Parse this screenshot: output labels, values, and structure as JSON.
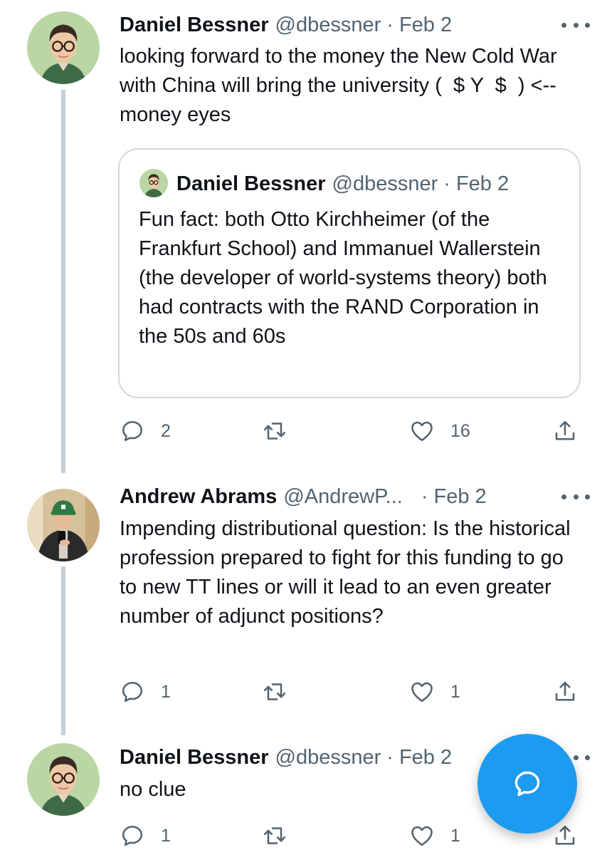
{
  "tweets": [
    {
      "name": "Daniel Bessner",
      "handle": "@dbessner",
      "separator": "·",
      "date": "Feb 2",
      "text": "looking forward to the money the New Cold War with China will bring the university (  $ Y  $  ) <--money eyes",
      "quote": {
        "name": "Daniel Bessner",
        "handle": "@dbessner",
        "separator": "·",
        "date": "Feb 2",
        "text": "Fun fact: both Otto Kirchheimer (of the Frankfurt School) and Immanuel Wallerstein (the developer of world-systems theory) both had contracts with the RAND Corporation in the 50s and 60s"
      },
      "reply_count": "2",
      "retweet_count": "",
      "like_count": "16"
    },
    {
      "name": "Andrew Abrams",
      "handle": "@AndrewP...",
      "separator": "·",
      "date": "Feb 2",
      "text": "Impending distributional question: Is the historical profession prepared to fight for this funding to go to new TT lines or will it lead to an even greater number of adjunct positions?",
      "reply_count": "1",
      "retweet_count": "",
      "like_count": "1"
    },
    {
      "name": "Daniel Bessner",
      "handle": "@dbessner",
      "separator": "·",
      "date": "Feb 2",
      "text": "no clue",
      "reply_count": "1",
      "retweet_count": "",
      "like_count": "1"
    }
  ],
  "icons": {
    "reply": "reply-icon",
    "retweet": "retweet-icon",
    "like": "heart-icon",
    "share": "share-icon",
    "more": "more-dots-icon",
    "compose": "compose-reply-icon"
  },
  "colors": {
    "accent": "#1d9bf0",
    "secondary_text": "#536471",
    "thread_line": "#c4cfd6",
    "border": "#cfd9de"
  }
}
